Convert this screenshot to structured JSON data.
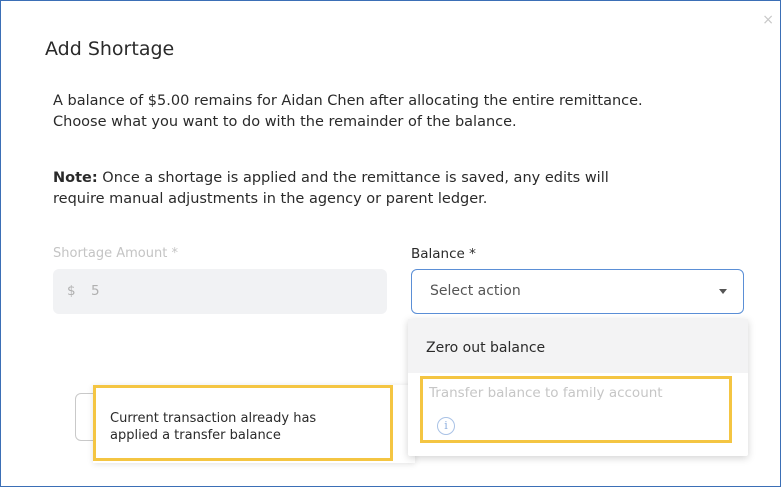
{
  "dialog": {
    "title": "Add Shortage",
    "close_icon": "×",
    "message_line1": "A balance of $5.00 remains for Aidan Chen after allocating the entire remittance.",
    "message_line2": "Choose what you want to do with the remainder of the balance.",
    "note_label": "Note:",
    "note_line1": " Once a shortage is applied and the remittance is saved, any edits will",
    "note_line2": "require manual adjustments in the agency or parent ledger."
  },
  "form": {
    "shortage_amount": {
      "label": "Shortage Amount *",
      "currency": "$",
      "value": "5"
    },
    "balance": {
      "label": "Balance *",
      "placeholder": "Select action"
    }
  },
  "dropdown": {
    "options": [
      {
        "label": "Zero out balance",
        "enabled": true
      },
      {
        "label": "Transfer balance to family account",
        "enabled": false
      }
    ],
    "info_icon": "i"
  },
  "tooltip": {
    "line1": "Current transaction already has",
    "line2": "applied a transfer balance"
  },
  "colors": {
    "highlight": "#f4c542",
    "select_border": "#5b8fd6",
    "frame_border": "#3b6fb6"
  }
}
